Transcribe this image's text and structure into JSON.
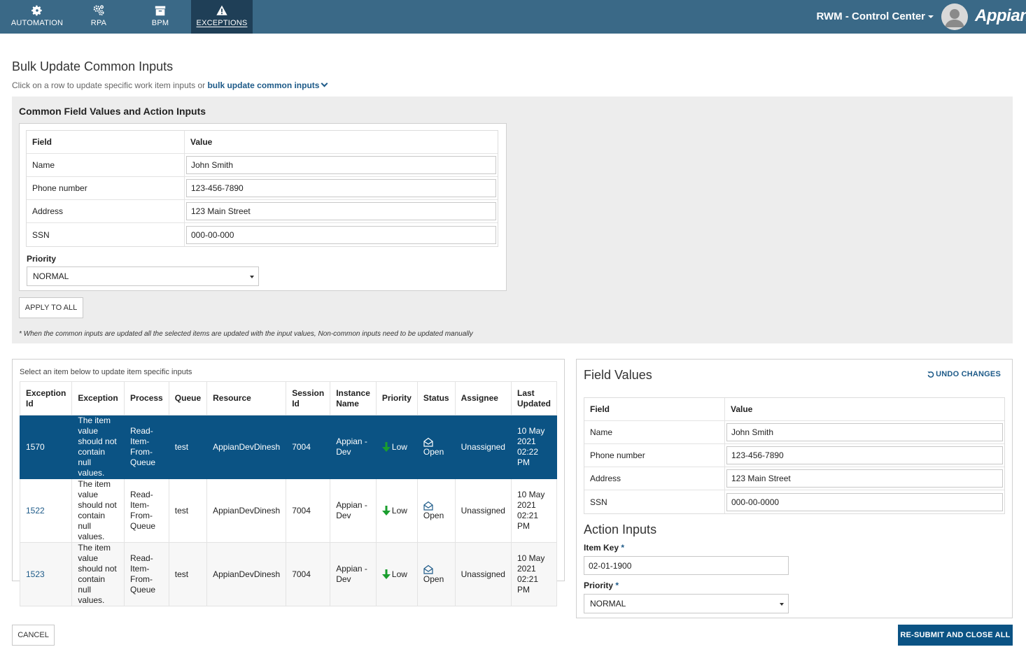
{
  "nav": {
    "tabs": [
      {
        "label": "AUTOMATION",
        "icon": "gear-icon"
      },
      {
        "label": "RPA",
        "icon": "gears-icon"
      },
      {
        "label": "BPM",
        "icon": "archive-box-icon"
      },
      {
        "label": "EXCEPTIONS",
        "icon": "warning-icon"
      }
    ],
    "app_title": "RWM - Control Center",
    "brand": "Appian"
  },
  "page": {
    "title": "Bulk Update Common Inputs",
    "subtitle_prefix": "Click on a row to update specific work item inputs or",
    "subtitle_link": "bulk update common inputs"
  },
  "common": {
    "title": "Common Field Values and Action Inputs",
    "header_field": "Field",
    "header_value": "Value",
    "fields": [
      {
        "field": "Name",
        "value": "John Smith"
      },
      {
        "field": "Phone number",
        "value": "123-456-7890"
      },
      {
        "field": "Address",
        "value": "123 Main Street"
      },
      {
        "field": "SSN",
        "value": "000-00-000"
      }
    ],
    "priority_label": "Priority",
    "priority_value": "NORMAL",
    "apply_button": "APPLY TO ALL",
    "note": "* When the common inputs are updated all the selected items are updated with the input values, Non-common inputs need to be updated manually"
  },
  "items": {
    "hint": "Select an item below to update item specific inputs",
    "columns": [
      "Exception Id",
      "Exception",
      "Process",
      "Queue",
      "Resource",
      "Session Id",
      "Instance Name",
      "Priority",
      "Status",
      "Assignee",
      "Last Updated"
    ],
    "rows": [
      {
        "id": "1570",
        "exception": "The item value should not contain null values.",
        "process": "Read-Item-From-Queue",
        "queue": "test",
        "resource": "AppianDevDinesh",
        "session": "7004",
        "instance": "Appian - Dev",
        "priority": "Low",
        "status": "Open",
        "assignee": "Unassigned",
        "updated": "10 May 2021 02:22 PM"
      },
      {
        "id": "1522",
        "exception": "The item value should not contain null values.",
        "process": "Read-Item-From-Queue",
        "queue": "test",
        "resource": "AppianDevDinesh",
        "session": "7004",
        "instance": "Appian - Dev",
        "priority": "Low",
        "status": "Open",
        "assignee": "Unassigned",
        "updated": "10 May 2021 02:21 PM"
      },
      {
        "id": "1523",
        "exception": "The item value should not contain null values.",
        "process": "Read-Item-From-Queue",
        "queue": "test",
        "resource": "AppianDevDinesh",
        "session": "7004",
        "instance": "Appian - Dev",
        "priority": "Low",
        "status": "Open",
        "assignee": "Unassigned",
        "updated": "10 May 2021 02:21 PM"
      }
    ]
  },
  "field_values": {
    "title": "Field Values",
    "undo": "UNDO CHANGES",
    "header_field": "Field",
    "header_value": "Value",
    "fields": [
      {
        "field": "Name",
        "value": "John Smith"
      },
      {
        "field": "Phone number",
        "value": "123-456-7890"
      },
      {
        "field": "Address",
        "value": "123 Main Street"
      },
      {
        "field": "SSN",
        "value": "000-00-0000"
      }
    ],
    "action_title": "Action Inputs",
    "item_key_label": "Item Key",
    "item_key_value": "02-01-1900",
    "priority_label": "Priority",
    "priority_value": "NORMAL",
    "required_mark": "*"
  },
  "footer": {
    "cancel": "CANCEL",
    "submit": "RE-SUBMIT AND CLOSE ALL"
  },
  "colors": {
    "nav_bg": "#3a6987",
    "nav_active": "#1f3f57",
    "selected_row": "#0b5384",
    "link": "#1d5a88",
    "low_priority_arrow": "#1a9e2e"
  }
}
